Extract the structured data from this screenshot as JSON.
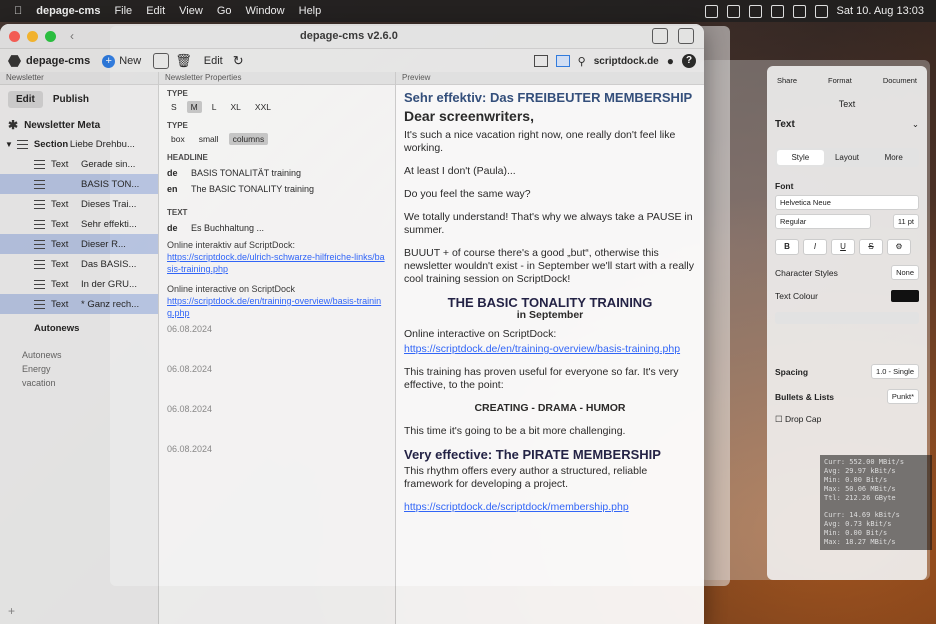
{
  "menubar": {
    "app": "depage-cms",
    "items": [
      "File",
      "Edit",
      "View",
      "Go",
      "Window",
      "Help"
    ],
    "datetime": "Sat 10. Aug 13:03"
  },
  "window": {
    "title": "depage-cms v2.6.0"
  },
  "toolbar": {
    "logo": "depage-cms",
    "new": "New",
    "edit": "Edit",
    "site": "scriptdock.de"
  },
  "panes": {
    "left_head": "Newsletter",
    "mid_head": "Newsletter Properties",
    "preview_head": "Preview"
  },
  "left": {
    "tabs": [
      "Edit",
      "Publish"
    ],
    "meta": "Newsletter Meta",
    "section_kind": "Section",
    "section_text": "Liebe Drehbu...",
    "rows": [
      {
        "kind": "Text",
        "text": "Gerade sin..."
      },
      {
        "kind": "",
        "text": "BASIS TON..."
      },
      {
        "kind": "Text",
        "text": "Dieses Trai..."
      },
      {
        "kind": "Text",
        "text": "Sehr effekti..."
      },
      {
        "kind": "Text",
        "text": "Dieser R..."
      },
      {
        "kind": "Text",
        "text": "Das BASIS..."
      },
      {
        "kind": "Text",
        "text": "In der GRU..."
      },
      {
        "kind": "Text",
        "text": "* Ganz rech..."
      }
    ],
    "autonews": "Autonews",
    "sidebar_extra": [
      "Autonews",
      "Energy",
      "vacation"
    ],
    "add": "+"
  },
  "mid": {
    "type_label": "TYPE",
    "type_options": [
      "S",
      "M",
      "L",
      "XL",
      "XXL"
    ],
    "type2_options": [
      "box",
      "small",
      "columns"
    ],
    "headline_label": "HEADLINE",
    "headline": [
      {
        "lang": "de",
        "text": "BASIS TONALITÄT training"
      },
      {
        "lang": "en",
        "text": "The BASIC TONALITY training"
      }
    ],
    "text_label": "TEXT",
    "text_lang": "de",
    "text_de": "Es Buchhaltung ...",
    "text_body": "Online interaktiv auf ScriptDock:",
    "text_link": "https://scriptdock.de/ulrich-schwarze-hilfreiche-links/basis-training.php",
    "text_body2": "Online interactive on ScriptDock",
    "text_link2": "https://scriptdock.de/en/training-overview/basis-training.php",
    "dates": [
      "06.08.2024",
      "06.08.2024",
      "06.08.2024",
      "06.08.2024"
    ]
  },
  "preview": {
    "heading1": "Sehr effektiv: Das FREIBEUTER MEMBERSHIP",
    "heading2": "Dear screenwriters,",
    "p1": "It's such a nice vacation right now, one really don't feel like working.",
    "p2": "At least I don't (Paula)...",
    "p3": "Do you feel the same way?",
    "p4": "We totally understand! That's why we always take a PAUSE in summer.",
    "p5": "BUUUT + of course there's a good „but“, otherwise this newsletter wouldn't exist - in September we'll start with a really cool training session on ScriptDock!",
    "h3_1": "THE BASIC TONALITY TRAINING",
    "h3_1b": "in September",
    "p6": "Online interactive on ScriptDock:",
    "link1": "https://scriptdock.de/en/training-overview/basis-training.php",
    "p7": "This training has proven useful for everyone so far. It's very effective, to the point:",
    "p8": "CREATING - DRAMA - HUMOR",
    "p9": "This time it's going to be a bit more challenging.",
    "h3_2": "Very effective: The PIRATE MEMBERSHIP",
    "p10": "This rhythm offers every author a structured, reliable framework for developing a project.",
    "link2": "https://scriptdock.de/scriptdock/membership.php"
  },
  "inspector": {
    "tabs": [
      "Share",
      "Format",
      "Document"
    ],
    "title": "Text",
    "style_pop": "Text",
    "segs": [
      "Style",
      "Layout",
      "More"
    ],
    "font_label": "Font",
    "font": "Helvetica Neue",
    "weight": "Regular",
    "size": "11 pt",
    "fmt": [
      "B",
      "I",
      "U",
      "S"
    ],
    "char_styles_label": "Character Styles",
    "char_styles": "None",
    "colour_label": "Text Colour",
    "spacing_label": "Spacing",
    "spacing": "1.0 - Single",
    "bullets_label": "Bullets & Lists",
    "bullets": "Punkt*",
    "dropcap_label": "Drop Cap",
    "colour": "#111111"
  },
  "stats": [
    "Curr: 552.00 MBit/s",
    "Avg: 29.97 kBit/s",
    "Min: 0.00 Bit/s",
    "Max: 50.06 MBit/s",
    "Ttl: 212.26 GByte",
    "",
    "Curr: 14.69 kBit/s",
    "Avg: 0.73 kBit/s",
    "Min: 0.00 Bit/s",
    "Max: 18.27 MBit/s"
  ]
}
